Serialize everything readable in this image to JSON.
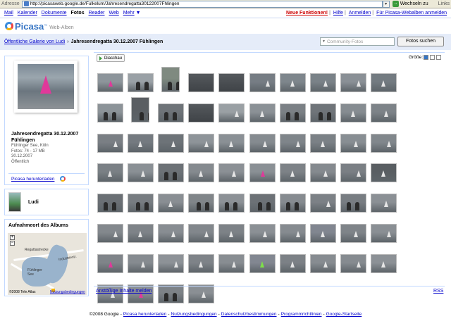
{
  "browser": {
    "address_label": "Adresse",
    "url": "http://picasaweb.google.de/Fulkelum/Jahresendregatta30122007Fhlingen",
    "go_label": "Wechseln zu",
    "links_label": "Links"
  },
  "gbar": {
    "left": [
      {
        "label": "Mail",
        "active": false
      },
      {
        "label": "Kalender",
        "active": false
      },
      {
        "label": "Dokumente",
        "active": false
      },
      {
        "label": "Fotos",
        "active": true
      },
      {
        "label": "Reader",
        "active": false
      },
      {
        "label": "Web",
        "active": false
      }
    ],
    "more_label": "Mehr",
    "new_features": "Neue Funktionen!",
    "help": "Hilfe",
    "login": "Anmelden",
    "picasa_login": "Für Picasa-Webalben anmelden"
  },
  "logo": {
    "name": "Picasa",
    "tm": "™",
    "sub": "Web-Alben"
  },
  "header": {
    "breadcrumb_link": "Öffentliche Galerie von Ludi",
    "breadcrumb_sep": "›",
    "album_title": "Jahresendregatta 30.12.2007 Fühlingen",
    "community_placeholder": "Community-Fotos",
    "search_button": "Fotos suchen"
  },
  "album": {
    "title": "Jahresendregatta 30.12.2007 Fühlingen",
    "location": "Fühlinger See, Köln",
    "photos": "Fotos: 74 - 17 MB",
    "date": "30.12.2007",
    "visibility": "Öffentlich",
    "download_link": "Picasa herunterladen"
  },
  "user": {
    "name": "Ludi"
  },
  "map": {
    "title": "Aufnahmeort des Albums",
    "labels": [
      "Regattastrecke",
      "Industriestr.",
      "Fühlinger See"
    ],
    "copyright": "©2008 Tele Atlas",
    "terms": "Nutzungsbedingungen",
    "zoom_in": "+",
    "zoom_out": "−"
  },
  "toolbar": {
    "slideshow": "Diaschau",
    "size_label": "Größe:"
  },
  "thumbnails": [
    {
      "kind": "pink",
      "shade": "#8d959b"
    },
    {
      "kind": "people",
      "shade": "#9aa1a6"
    },
    {
      "kind": "tall",
      "shade": "#7f8a80"
    },
    {
      "kind": "dark",
      "shade": "#5e646a"
    },
    {
      "kind": "dark",
      "shade": "#6b7075"
    },
    {
      "kind": "sail",
      "shade": "#767d84"
    },
    {
      "kind": "sail",
      "shade": "#7e868c"
    },
    {
      "kind": "sail",
      "shade": "#7a8288"
    },
    {
      "kind": "sail",
      "shade": "#8a9096"
    },
    {
      "kind": "sail",
      "shade": "#737b81"
    },
    {
      "kind": "people",
      "shade": "#8c9398"
    },
    {
      "kind": "tall",
      "shade": "#5a5e62"
    },
    {
      "kind": "people",
      "shade": "#6e7378"
    },
    {
      "kind": "dark",
      "shade": "#4e5358"
    },
    {
      "kind": "sail",
      "shade": "#9aa0a4"
    },
    {
      "kind": "sail",
      "shade": "#8b9196"
    },
    {
      "kind": "people",
      "shade": "#7b8085"
    },
    {
      "kind": "people",
      "shade": "#6f7479"
    },
    {
      "kind": "sail",
      "shade": "#868c91"
    },
    {
      "kind": "sail",
      "shade": "#7d8388"
    },
    {
      "kind": "sail",
      "shade": "#7a7f84"
    },
    {
      "kind": "sail",
      "shade": "#747a80"
    },
    {
      "kind": "sail",
      "shade": "#6d7378"
    },
    {
      "kind": "sail",
      "shade": "#8e9499"
    },
    {
      "kind": "sail",
      "shade": "#8a9095"
    },
    {
      "kind": "sail",
      "shade": "#858b90"
    },
    {
      "kind": "sail",
      "shade": "#7f858a"
    },
    {
      "kind": "sail",
      "shade": "#7b8186"
    },
    {
      "kind": "sail",
      "shade": "#888e93"
    },
    {
      "kind": "sail",
      "shade": "#81878c"
    },
    {
      "kind": "sail",
      "shade": "#7a8085"
    },
    {
      "kind": "sail",
      "shade": "#8a9095"
    },
    {
      "kind": "people",
      "shade": "#6c7176"
    },
    {
      "kind": "sail",
      "shade": "#858a8f"
    },
    {
      "kind": "sail",
      "shade": "#8b9095"
    },
    {
      "kind": "pink",
      "shade": "#8a9095"
    },
    {
      "kind": "sail",
      "shade": "#7d8287"
    },
    {
      "kind": "sail",
      "shade": "#858a8f"
    },
    {
      "kind": "sail",
      "shade": "#7a7f84"
    },
    {
      "kind": "sail",
      "shade": "#595e62"
    },
    {
      "kind": "people",
      "shade": "#6a6f74"
    },
    {
      "kind": "people",
      "shade": "#777c81"
    },
    {
      "kind": "sail",
      "shade": "#898e93"
    },
    {
      "kind": "people",
      "shade": "#808589"
    },
    {
      "kind": "people",
      "shade": "#8c9196"
    },
    {
      "kind": "people",
      "shade": "#6c7176"
    },
    {
      "kind": "people",
      "shade": "#868b90"
    },
    {
      "kind": "sail",
      "shade": "#7c8186"
    },
    {
      "kind": "people",
      "shade": "#787d82"
    },
    {
      "kind": "sail",
      "shade": "#8b9095"
    },
    {
      "kind": "sail",
      "shade": "#83888d"
    },
    {
      "kind": "sail",
      "shade": "#7e8388"
    },
    {
      "kind": "sail",
      "shade": "#888d92"
    },
    {
      "kind": "sail",
      "shade": "#82878c"
    },
    {
      "kind": "sail",
      "shade": "#7d8287"
    },
    {
      "kind": "sail",
      "shade": "#8b9095"
    },
    {
      "kind": "sail",
      "shade": "#868b90"
    },
    {
      "kind": "sail",
      "shade": "#818690"
    },
    {
      "kind": "sail",
      "shade": "#7f8489"
    },
    {
      "kind": "sail",
      "shade": "#8a8f94"
    },
    {
      "kind": "pink",
      "shade": "#7f8489"
    },
    {
      "kind": "sail",
      "shade": "#868b90"
    },
    {
      "kind": "sail",
      "shade": "#8d9297"
    },
    {
      "kind": "sail",
      "shade": "#7e8388"
    },
    {
      "kind": "sail",
      "shade": "#888d92"
    },
    {
      "kind": "green",
      "shade": "#828791"
    },
    {
      "kind": "sail",
      "shade": "#7c8186"
    },
    {
      "kind": "sail",
      "shade": "#878c91"
    },
    {
      "kind": "sail",
      "shade": "#868b90"
    },
    {
      "kind": "sail",
      "shade": "#8c9196"
    },
    {
      "kind": "sail",
      "shade": "#8f9499"
    },
    {
      "kind": "pink",
      "shade": "#8a8f94"
    },
    {
      "kind": "people",
      "shade": "#7d8287"
    },
    {
      "kind": "sail",
      "shade": "#8a8f94"
    }
  ],
  "footer": {
    "copyright": "©2008 Google",
    "links": [
      "Picasa herunterladen",
      "Nutzungsbedingungen",
      "Datenschutzbestimmungen",
      "Programmrichtlinien",
      "Google-Startseite"
    ]
  },
  "main": {
    "report": "Anstößige Inhalte melden",
    "rss": "RSS"
  },
  "colors": {
    "accent_blue": "#3574c4",
    "link": "#0000cc",
    "band": "#e5ecf9",
    "border": "#c3d9ff",
    "new": "#cc0000"
  }
}
